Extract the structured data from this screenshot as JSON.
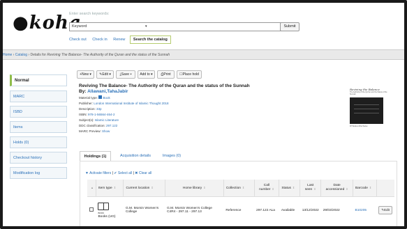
{
  "header": {
    "logo": "koha",
    "search_label": "Enter search keywords:",
    "search_type": "Keyword",
    "submit_label": "Submit",
    "subnav": [
      "Check out",
      "Check in",
      "Renew"
    ],
    "subnav_active": "Search the catalog"
  },
  "breadcrumb": {
    "home": "Home",
    "catalog": "Catalog",
    "prefix": "Details for",
    "record": "Reviving The Balance- The Authority of the Quran and the status of the Sunnah"
  },
  "sidebar": {
    "items": [
      {
        "label": "Normal"
      },
      {
        "label": "MARC"
      },
      {
        "label": "ISBD"
      },
      {
        "label": "Items"
      },
      {
        "label": "Holds (0)"
      },
      {
        "label": "Checkout history"
      },
      {
        "label": "Modification log"
      }
    ]
  },
  "toolbar": {
    "new": "New",
    "edit": "Edit",
    "save": "Save",
    "add_to": "Add to",
    "print": "Print",
    "place_hold": "Place hold"
  },
  "record": {
    "title": "Reviving The Balance- The Authority of the Quran and the status of the Sunnah",
    "author_label": "By:",
    "author": "Allawani,TahaJabir",
    "material_label": "Material type:",
    "material": "Book",
    "publisher_label": "Publisher:",
    "publisher": "London International Institute of Islamic Thought 2018",
    "description_label": "Description:",
    "description": "33p",
    "isbn_label": "ISBN:",
    "isbn": "978-1-56564-464-2",
    "subject_label": "Subject(s):",
    "subject": "Islamic Literature",
    "ddc_label": "DDC classification:",
    "ddc": "297.122",
    "marc_label": "MARC Preview:",
    "marc": "Show"
  },
  "cover": {
    "title": "Reviving the Balance",
    "subtitle": "The Authority of the Qur'an and the Status of the Sunnah",
    "footer": "IIIT Books-in-Brief Series"
  },
  "tabs": [
    {
      "label": "Holdings (1)"
    },
    {
      "label": "Acquisition details"
    },
    {
      "label": "Images (0)"
    }
  ],
  "filters": {
    "activate": "Activate filters",
    "sep": "|",
    "select_all": "Select all",
    "clear_all": "Clear all"
  },
  "table": {
    "headers": [
      "Item type",
      "Current location",
      "Home library",
      "Collection",
      "Call number",
      "Status",
      "Last seen",
      "Date accessioned",
      "Barcode"
    ],
    "row": {
      "item_type_small": "BOOK",
      "item_type": "Books (UG)",
      "current_location": "G.M. Momin Women's College",
      "home_library": "G.M. Momin Women's College C4R4 - 297.11 - 297.13",
      "collection": "Reference",
      "call_number": "297.122 ALa",
      "status": "Available",
      "last_seen": "13/12/2022",
      "date_accessioned": "29/03/2022",
      "barcode": "B10205",
      "edit": "Edit"
    }
  }
}
